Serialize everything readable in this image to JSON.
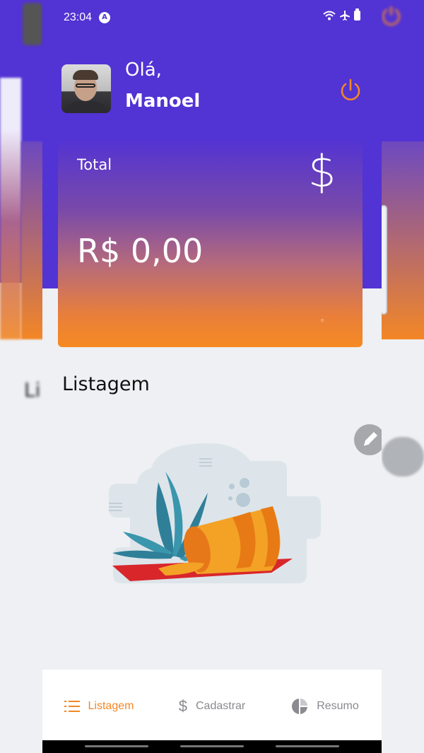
{
  "status_bar": {
    "time": "23:04",
    "icons": [
      "android-auto-icon",
      "wifi-icon",
      "airplane-icon",
      "battery-icon"
    ]
  },
  "header": {
    "greeting": "Olá,",
    "user_name": "Manoel",
    "logout_icon": "power-icon"
  },
  "total_card": {
    "label": "Total",
    "value": "R$ 0,00",
    "icon": "dollar-icon"
  },
  "listing": {
    "title": "Listagem",
    "empty_state_icon": "empty-pot-illustration"
  },
  "ghost_left": {
    "text": "Li"
  },
  "bottom_nav": {
    "items": [
      {
        "label": "Listagem",
        "icon": "list-icon",
        "active": true
      },
      {
        "label": "Cadastrar",
        "icon": "dollar-icon",
        "active": false
      },
      {
        "label": "Resumo",
        "icon": "pie-chart-icon",
        "active": false
      }
    ]
  },
  "colors": {
    "primary": "#5233d4",
    "accent": "#f38726",
    "background": "#eef0f3",
    "inactive": "#8a8a8f"
  }
}
